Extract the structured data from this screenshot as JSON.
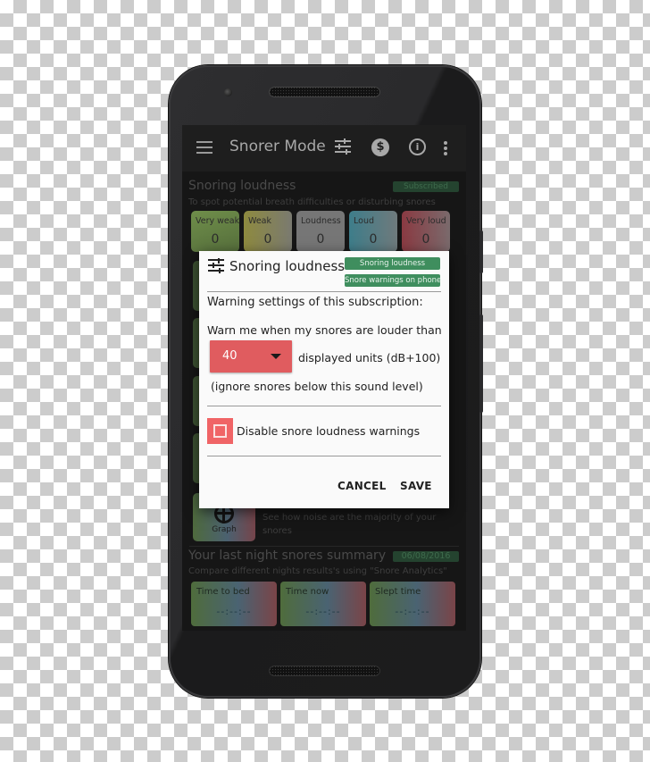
{
  "app": {
    "title": "Snorer Mode",
    "icons": [
      "menu-icon",
      "sliders-icon",
      "dollar-icon",
      "info-icon",
      "more-vert-icon"
    ]
  },
  "loudness_section": {
    "title": "Snoring loudness",
    "subtitle": "To spot potential breath difficulties or disturbing snores",
    "badge": "Subscribed",
    "levels": [
      {
        "label": "Very weak",
        "value": "0",
        "color": "#6f8e4a"
      },
      {
        "label": "Weak",
        "value": "0",
        "color": "#8e8a3f"
      },
      {
        "label": "Loudness",
        "value": "0",
        "color": "#7a7a7a"
      },
      {
        "label": "Loud",
        "value": "0",
        "color": "#3e7d8a"
      },
      {
        "label": "Very loud",
        "value": "0",
        "color": "#8a3a42"
      }
    ]
  },
  "graph_section": {
    "label": "Graph",
    "description": "See how noise are the majority of your snores"
  },
  "summary_section": {
    "title": "Your last night snores summary",
    "date_badge": "06/08/2016",
    "subtitle": "Compare different nights results's using \"Snore Analytics\"",
    "cards": [
      {
        "label": "Time to bed",
        "value": "--:--:--"
      },
      {
        "label": "Time now",
        "value": "--:--:--"
      },
      {
        "label": "Slept time",
        "value": "--:--:--"
      }
    ]
  },
  "dialog": {
    "title": "Snoring loudness",
    "chips": [
      "Snoring loudness",
      "Snore warnings on phone"
    ],
    "heading": "Warning settings of this subscription:",
    "warn_text": "Warn me when my snores are louder than",
    "threshold_value": "40",
    "units_text": "displayed units (dB+100)",
    "ignore_text": "(ignore snores below this sound level)",
    "checkbox_label": "Disable snore loudness warnings",
    "checkbox_checked": false,
    "cancel_label": "CANCEL",
    "save_label": "SAVE",
    "accent_color": "#e05c5f",
    "chip_color": "#3f8e5e"
  }
}
